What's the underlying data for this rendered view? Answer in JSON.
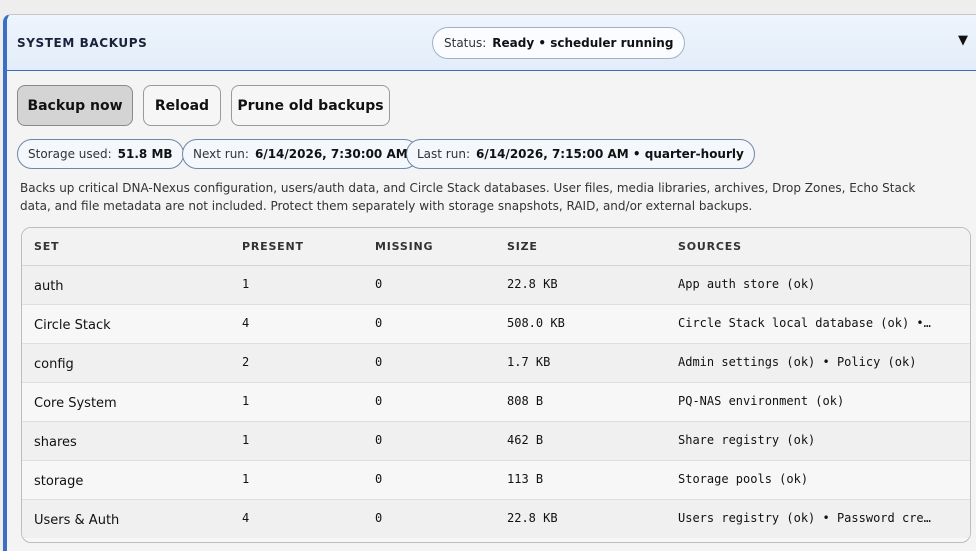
{
  "header": {
    "title": "SYSTEM BACKUPS",
    "status_label": "Status:",
    "status_value": "Ready • scheduler running",
    "collapse_icon": "triangle-down-icon"
  },
  "actions": {
    "backup_now": "Backup now",
    "reload": "Reload",
    "prune": "Prune old backups"
  },
  "stats": {
    "storage_label": "Storage used:",
    "storage_value": "51.8 MB",
    "next_label": "Next run:",
    "next_value": "6/14/2026, 7:30:00 AM",
    "last_label": "Last run:",
    "last_value": "6/14/2026, 7:15:00 AM • quarter-hourly"
  },
  "description": "Backs up critical DNA-Nexus configuration, users/auth data, and Circle Stack databases. User files, media libraries, archives, Drop Zones, Echo Stack data, and file metadata are not included. Protect them separately with storage snapshots, RAID, and/or external backups.",
  "table": {
    "columns": [
      "SET",
      "PRESENT",
      "MISSING",
      "SIZE",
      "SOURCES"
    ],
    "rows": [
      {
        "set": "auth",
        "present": "1",
        "missing": "0",
        "size": "22.8 KB",
        "sources": "App auth store (ok)"
      },
      {
        "set": "Circle Stack",
        "present": "4",
        "missing": "0",
        "size": "508.0 KB",
        "sources": "Circle Stack local database (ok) •…"
      },
      {
        "set": "config",
        "present": "2",
        "missing": "0",
        "size": "1.7 KB",
        "sources": "Admin settings (ok) • Policy (ok)"
      },
      {
        "set": "Core System",
        "present": "1",
        "missing": "0",
        "size": "808 B",
        "sources": "PQ-NAS environment (ok)"
      },
      {
        "set": "shares",
        "present": "1",
        "missing": "0",
        "size": "462 B",
        "sources": "Share registry (ok)"
      },
      {
        "set": "storage",
        "present": "1",
        "missing": "0",
        "size": "113 B",
        "sources": "Storage pools (ok)"
      },
      {
        "set": "Users & Auth",
        "present": "4",
        "missing": "0",
        "size": "22.8 KB",
        "sources": "Users registry (ok) • Password cre…"
      }
    ]
  },
  "colors": {
    "accent": "#3a6fc4",
    "header_bg": "#e3edf9"
  }
}
